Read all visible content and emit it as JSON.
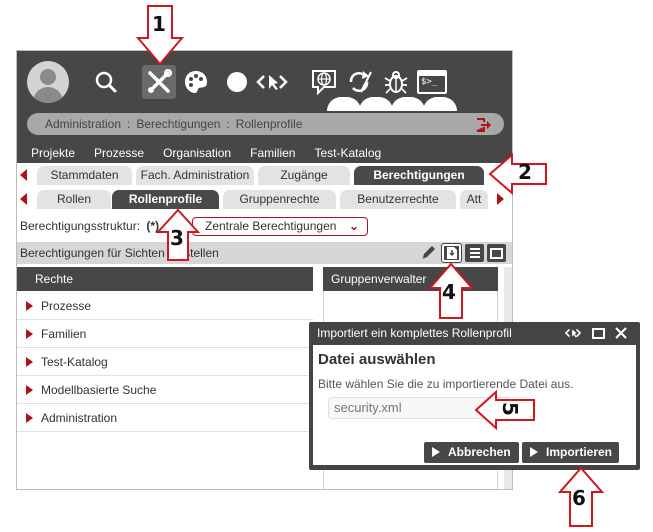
{
  "toolbar": {
    "icons": [
      "user-avatar",
      "search-icon",
      "tools-icon",
      "palette-icon",
      "circle-icon",
      "code-arrows-icon",
      "globe-chat-icon",
      "refresh-brush-icon",
      "bug-icon",
      "terminal-icon"
    ],
    "terminal_label": "$>_"
  },
  "breadcrumb": {
    "items": [
      "Administration",
      "Berechtigungen",
      "Rollenprofile"
    ],
    "separator": ":"
  },
  "menu": {
    "items": [
      "Projekte",
      "Prozesse",
      "Organisation",
      "Familien",
      "Test-Katalog"
    ]
  },
  "tabs1": {
    "items": [
      "Stammdaten",
      "Fach. Administration",
      "Zugänge",
      "Berechtigungen"
    ],
    "active": "Berechtigungen"
  },
  "tabs2": {
    "items": [
      "Rollen",
      "Rollenprofile",
      "Gruppenrechte",
      "Benutzerrechte",
      "Att"
    ],
    "active": "Rollenprofile"
  },
  "structure": {
    "label": "Berechtigungsstruktur:",
    "marker": "(*)",
    "value": "Zentrale Berechtigungen"
  },
  "panel": {
    "title": "Berechtigungen für Sichten einstellen"
  },
  "table": {
    "col1": "Rechte",
    "col2": "Gruppenverwalter",
    "rows": [
      "Prozesse",
      "Familien",
      "Test-Katalog",
      "Modellbasierte Suche",
      "Administration"
    ]
  },
  "dialog": {
    "title": "Importiert ein komplettes Rollenprofil",
    "heading": "Datei auswählen",
    "text": "Bitte wählen Sie die zu importierende Datei aus.",
    "file_value": "security.xml",
    "cancel_label": "Abbrechen",
    "import_label": "Importieren"
  },
  "callouts": [
    "1",
    "2",
    "3",
    "4",
    "5",
    "6"
  ],
  "colors": {
    "accent": "#b0121b",
    "dark": "#474747",
    "callout_fill": "#ffffff",
    "callout_stroke": "#d0161e"
  }
}
